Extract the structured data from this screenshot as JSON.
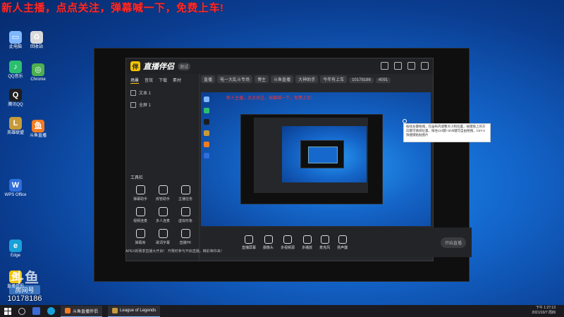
{
  "banner": "新人主播，点点关注，弹幕喊一下，免费上车!",
  "desktop_icons": [
    {
      "label": "此电脑",
      "color": "#7fb7ff",
      "glyph": "▭"
    },
    {
      "label": "回收站",
      "color": "#d9d9d9",
      "glyph": "♻"
    },
    {
      "label": "QQ音乐",
      "color": "#2bbf6f",
      "glyph": "♪"
    },
    {
      "label": "腾讯QQ",
      "color": "#1d1d1d",
      "glyph": "Q"
    },
    {
      "label": "英雄联盟",
      "color": "#c79a3a",
      "glyph": "L"
    },
    {
      "label": "Chrome",
      "color": "#4caf50",
      "glyph": "◎"
    },
    {
      "label": "斗鱼直播",
      "color": "#f47b20",
      "glyph": "鱼"
    },
    {
      "label": "WPS Office",
      "color": "#2f6ddc",
      "glyph": "W"
    },
    {
      "label": "Edge",
      "color": "#1aa0d8",
      "glyph": "e"
    },
    {
      "label": "直播伴侣",
      "color": "#f5c400",
      "glyph": "伴"
    }
  ],
  "app": {
    "logo": "直播伴侣",
    "version_badge": "测试",
    "side_tabs": [
      "场景",
      "音效",
      "下载",
      "素材"
    ],
    "scenes": [
      "文本 1",
      "全屏 1"
    ],
    "tools_title": "工具栏",
    "tools": [
      "弹幕助手",
      "房管助手",
      "主播任务",
      "视频连麦",
      "多人连麦",
      "虚拟形象",
      "弹幕库",
      "歌词字幕",
      "直播PK"
    ],
    "header_chips": [
      "直播",
      "电一大乱斗专场",
      "博主",
      "斗鱼直播",
      "大神助手",
      "今年有上车",
      "10178186",
      "4091"
    ],
    "preview_text": "新人主播，点点关注，弹幕喊一下，免费上车!",
    "bottom_buttons": [
      "直播屏幕",
      "摄像头",
      "多视频源",
      "多播放",
      "麦克风",
      "扬声器"
    ],
    "go_live": "开始直播",
    "notice": "APEX新赛季直播大开启！ 开赛时参与开启直播，精彩等你来！"
  },
  "tooltip": "按住左键拖拽，在画布内调整大小和位置，按键盘上的方向键可微调位置，按住Ctrl键+Shift键可自由拖拽，Ctrl+V快捷键粘贴图片",
  "watermark": {
    "logo": "斗鱼",
    "tag": "房间号",
    "room_id": "10178186"
  },
  "taskbar": {
    "apps": [
      {
        "label": "斗鱼直播伴侣",
        "color": "#f47b20"
      },
      {
        "label": "League of Legends",
        "color": "#c79a3a"
      }
    ],
    "time": "下午 1:27:13",
    "date": "2021/10/7 周四"
  }
}
